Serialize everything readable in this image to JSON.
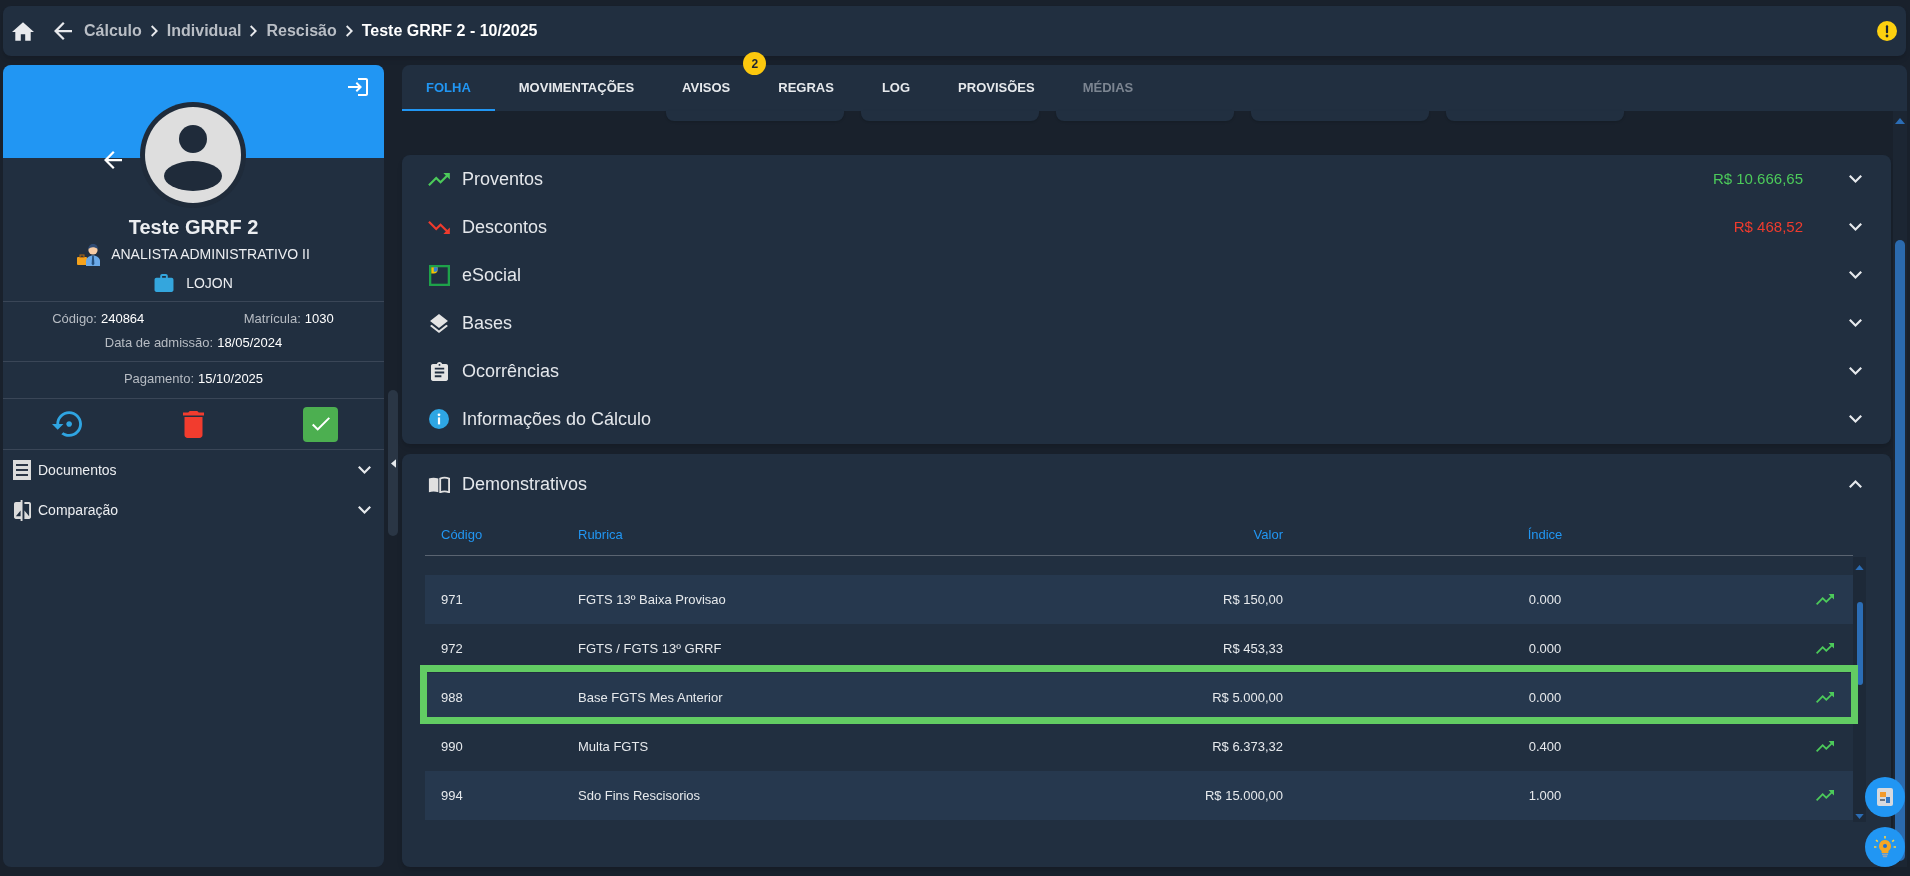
{
  "breadcrumb": {
    "links": [
      "Cálculo",
      "Individual",
      "Rescisão"
    ],
    "current": "Teste GRRF 2 - 10/2025"
  },
  "employee": {
    "name": "Teste GRRF 2",
    "role": "ANALISTA ADMINISTRATIVO II",
    "store": "LOJON",
    "details": [
      {
        "label": "Código:",
        "value": "240864"
      },
      {
        "label": "Matrícula:",
        "value": "1030"
      },
      {
        "label": "Data de admissão:",
        "value": "18/05/2024"
      }
    ],
    "payment": {
      "label": "Pagamento:",
      "value": "15/10/2025"
    }
  },
  "side_sections": [
    {
      "kind": "documents",
      "label": "Documentos",
      "expanded": false
    },
    {
      "kind": "comparison",
      "label": "Comparação",
      "expanded": false
    }
  ],
  "tabs": [
    {
      "label": "FOLHA",
      "selected": true,
      "disabled": false
    },
    {
      "label": "MOVIMENTAÇÕES",
      "selected": false,
      "disabled": false
    },
    {
      "label": "AVISOS",
      "selected": false,
      "disabled": false,
      "badge": "2"
    },
    {
      "label": "REGRAS",
      "selected": false,
      "disabled": false
    },
    {
      "label": "LOG",
      "selected": false,
      "disabled": false
    },
    {
      "label": "PROVISÕES",
      "selected": false,
      "disabled": false
    },
    {
      "label": "MÉDIAS",
      "selected": false,
      "disabled": true
    }
  ],
  "sections": [
    {
      "kind": "earnings",
      "label": "Proventos",
      "amount": "R$ 10.666,65",
      "expanded": false
    },
    {
      "kind": "deductions",
      "label": "Descontos",
      "amount": "R$ 468,52",
      "expanded": false
    },
    {
      "kind": "esocial",
      "label": "eSocial",
      "expanded": false
    },
    {
      "kind": "bases",
      "label": "Bases",
      "expanded": false
    },
    {
      "kind": "occurrences",
      "label": "Ocorrências",
      "expanded": false
    },
    {
      "kind": "info",
      "label": "Informações do Cálculo",
      "expanded": false
    }
  ],
  "statements": {
    "title": "Demonstrativos",
    "expanded": true,
    "columns": [
      "Código",
      "Rubrica",
      "Valor",
      "Índice"
    ],
    "rows": [
      {
        "code": "971",
        "description": "FGTS 13º Baixa Provisao",
        "value": "R$ 150,00",
        "index": "0.000",
        "highlighted": false
      },
      {
        "code": "972",
        "description": "FGTS / FGTS 13º GRRF",
        "value": "R$ 453,33",
        "index": "0.000",
        "highlighted": false
      },
      {
        "code": "988",
        "description": "Base FGTS Mes Anterior",
        "value": "R$ 5.000,00",
        "index": "0.000",
        "highlighted": true
      },
      {
        "code": "990",
        "description": "Multa FGTS",
        "value": "R$ 6.373,32",
        "index": "0.400",
        "highlighted": false
      },
      {
        "code": "994",
        "description": "Sdo Fins Rescisorios",
        "value": "R$ 15.000,00",
        "index": "1.000",
        "highlighted": false
      }
    ]
  }
}
